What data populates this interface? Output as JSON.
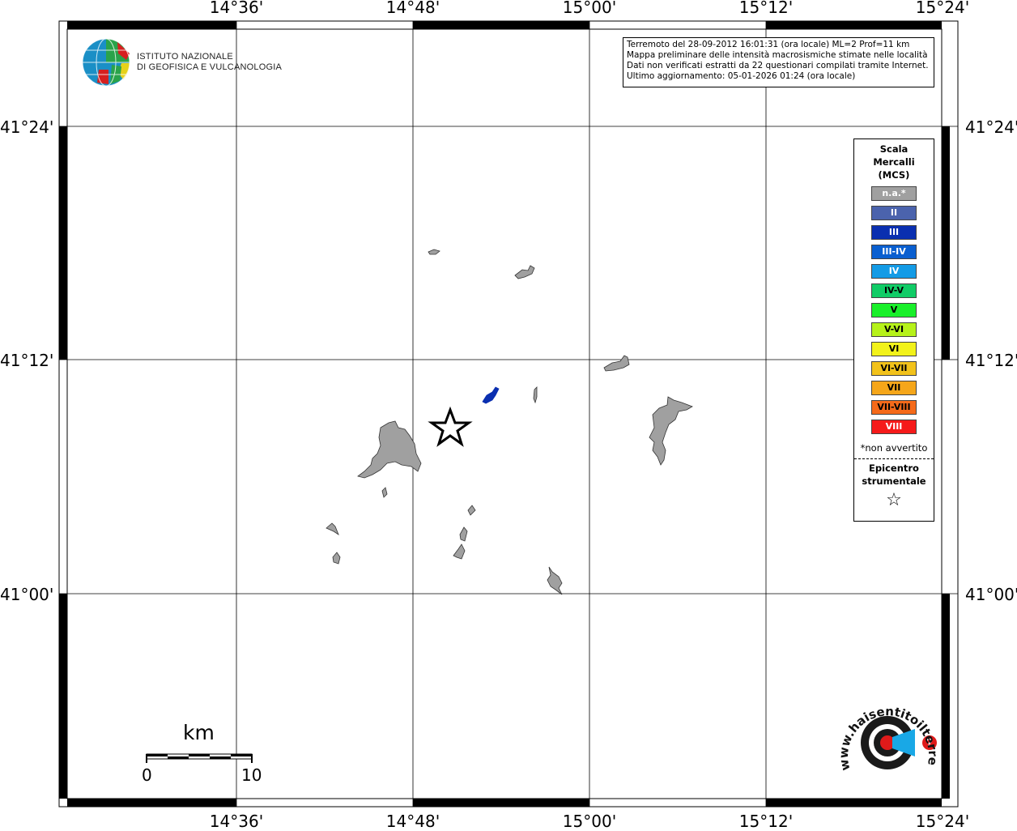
{
  "map": {
    "lon_labels": [
      "14°36'",
      "14°48'",
      "15°00'",
      "15°12'",
      "15°24'"
    ],
    "lat_labels": [
      "41°24'",
      "41°12'",
      "41°00'"
    ]
  },
  "info": {
    "line1": "Terremoto del 28-09-2012 16:01:31 (ora locale) ML=2 Prof=11 km",
    "line2": "Mappa preliminare delle intensità macrosismiche stimate nelle località",
    "line3": "Dati non verificati estratti da 22 questionari compilati tramite Internet.",
    "line4": "Ultimo aggiornamento: 05-01-2026 01:24 (ora locale)"
  },
  "logo": {
    "line1": "ISTITUTO NAZIONALE",
    "line2": "DI GEOFISICA E VULCANOLOGIA"
  },
  "legend": {
    "title1": "Scala",
    "title2": "Mercalli",
    "title3": "(MCS)",
    "items": [
      {
        "label": "n.a.*",
        "color": "#a0a0a0",
        "text_color": "#ffffff"
      },
      {
        "label": "II",
        "color": "#4b63ad",
        "text_color": "#ffffff"
      },
      {
        "label": "III",
        "color": "#0a2fb0",
        "text_color": "#ffffff"
      },
      {
        "label": "III-IV",
        "color": "#0a5fd0",
        "text_color": "#ffffff"
      },
      {
        "label": "IV",
        "color": "#139be6",
        "text_color": "#ffffff"
      },
      {
        "label": "IV-V",
        "color": "#10cc66",
        "text_color": "#000000"
      },
      {
        "label": "V",
        "color": "#19f02a",
        "text_color": "#000000"
      },
      {
        "label": "V-VI",
        "color": "#b6f21a",
        "text_color": "#000000"
      },
      {
        "label": "VI",
        "color": "#f2f21a",
        "text_color": "#000000"
      },
      {
        "label": "VI-VII",
        "color": "#f2c21a",
        "text_color": "#000000"
      },
      {
        "label": "VII",
        "color": "#f5a61a",
        "text_color": "#000000"
      },
      {
        "label": "VII-VIII",
        "color": "#f56a1a",
        "text_color": "#000000"
      },
      {
        "label": "VIII",
        "color": "#f51a1a",
        "text_color": "#ffffff"
      }
    ],
    "note": "*non avvertito",
    "epicenter1": "Epicentro",
    "epicenter2": "strumentale",
    "epicenter_symbol": "☆"
  },
  "scale_bar": {
    "unit": "km",
    "start": "0",
    "end": "10"
  },
  "hst_logo": {
    "text": "www.haisentitoilterremoto.it"
  }
}
